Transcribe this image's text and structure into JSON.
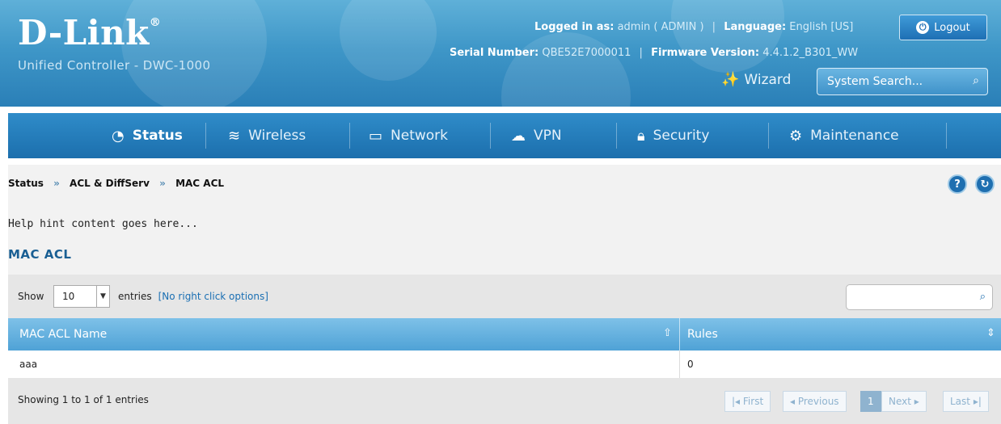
{
  "header": {
    "logo": "D-Link",
    "logo_mark": "®",
    "subtitle": "Unified Controller - DWC-1000",
    "logged_in_label": "Logged in as:",
    "logged_in_value": "admin ( ADMIN )",
    "language_label": "Language:",
    "language_value": "English [US]",
    "serial_label": "Serial Number:",
    "serial_value": "QBE52E7000011",
    "firmware_label": "Firmware Version:",
    "firmware_value": "4.4.1.2_B301_WW",
    "logout_label": "Logout",
    "wizard_label": "Wizard",
    "search_placeholder": "System Search..."
  },
  "nav": {
    "items": [
      {
        "label": "Status",
        "icon": "dashboard-icon"
      },
      {
        "label": "Wireless",
        "icon": "wifi-icon"
      },
      {
        "label": "Network",
        "icon": "monitor-icon"
      },
      {
        "label": "VPN",
        "icon": "cloud-lock-icon"
      },
      {
        "label": "Security",
        "icon": "lock-icon"
      },
      {
        "label": "Maintenance",
        "icon": "gears-icon"
      }
    ],
    "active": "Status"
  },
  "breadcrumb": {
    "items": [
      "Status",
      "ACL & DiffServ",
      "MAC ACL"
    ],
    "separator": "»"
  },
  "help_hint": "Help hint content goes here...",
  "section_title": "MAC ACL",
  "table": {
    "show_label": "Show",
    "page_size": "10",
    "entries_label": "entries",
    "right_click_note": "[No right click options]",
    "columns": [
      "MAC ACL Name",
      "Rules"
    ],
    "rows": [
      {
        "name": "aaa",
        "rules": "0"
      }
    ],
    "showing": "Showing 1 to 1 of 1 entries",
    "pager": {
      "first": "First",
      "previous": "Previous",
      "current": "1",
      "next": "Next",
      "last": "Last"
    }
  },
  "colors": {
    "accent": "#1f6fb0",
    "header_blue": "#3f97c8",
    "table_head": "#5eaddc"
  }
}
